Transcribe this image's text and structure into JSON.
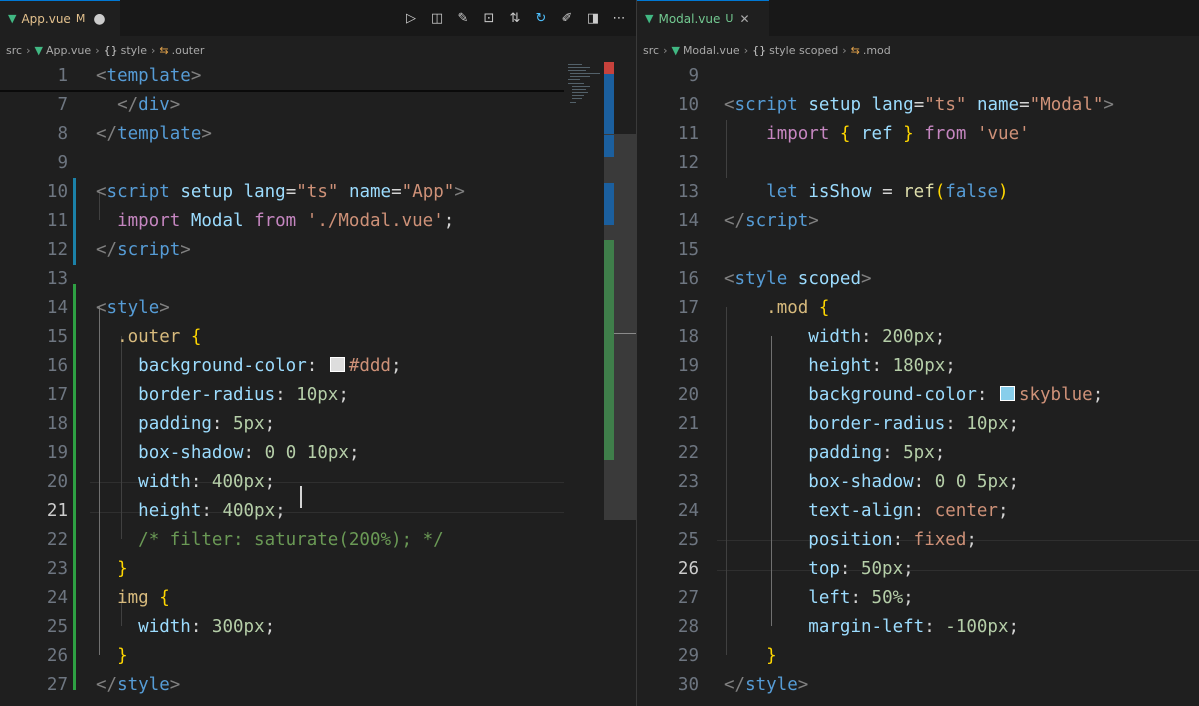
{
  "left": {
    "tab": {
      "icon": "vue-icon",
      "name": "App.vue",
      "status": "M",
      "dirty": "●"
    },
    "toolbar": [
      {
        "name": "run-icon",
        "glyph": "▷"
      },
      {
        "name": "open-preview-icon",
        "glyph": "◫"
      },
      {
        "name": "edit-note-icon",
        "glyph": "✎"
      },
      {
        "name": "compare-icon",
        "glyph": "⊡"
      },
      {
        "name": "git-compare-icon",
        "glyph": "⇅"
      },
      {
        "name": "refresh-icon",
        "glyph": "↻"
      },
      {
        "name": "pen-icon",
        "glyph": "✐"
      },
      {
        "name": "split-editor-icon",
        "glyph": "◨"
      },
      {
        "name": "more-actions-icon",
        "glyph": "⋯"
      }
    ],
    "breadcrumb": {
      "folder": "src",
      "file": "App.vue",
      "section_icon": "{}",
      "section": "style",
      "selector_icon": "⇆",
      "selector": ".outer"
    },
    "lines": [
      {
        "n": "1",
        "tokens": [
          [
            "t-p",
            "<"
          ],
          [
            "t-tag",
            "template"
          ],
          [
            "t-p",
            ">"
          ]
        ]
      },
      {
        "n": "7",
        "tokens": [
          [
            "t-txt",
            "  "
          ],
          [
            "t-p",
            "</"
          ],
          [
            "t-tag",
            "div"
          ],
          [
            "t-p",
            ">"
          ]
        ]
      },
      {
        "n": "8",
        "tokens": [
          [
            "t-p",
            "</"
          ],
          [
            "t-tag",
            "template"
          ],
          [
            "t-p",
            ">"
          ]
        ]
      },
      {
        "n": "9",
        "tokens": []
      },
      {
        "n": "10",
        "tokens": [
          [
            "t-p",
            "<"
          ],
          [
            "t-tag",
            "script"
          ],
          [
            "t-txt",
            " "
          ],
          [
            "t-attr",
            "setup"
          ],
          [
            "t-txt",
            " "
          ],
          [
            "t-attr",
            "lang"
          ],
          [
            "t-txt",
            "="
          ],
          [
            "t-str",
            "\"ts\""
          ],
          [
            "t-txt",
            " "
          ],
          [
            "t-attr",
            "name"
          ],
          [
            "t-txt",
            "="
          ],
          [
            "t-str",
            "\"App\""
          ],
          [
            "t-p",
            ">"
          ]
        ]
      },
      {
        "n": "11",
        "tokens": [
          [
            "t-txt",
            "  "
          ],
          [
            "t-kw",
            "import"
          ],
          [
            "t-txt",
            " "
          ],
          [
            "t-var",
            "Modal"
          ],
          [
            "t-txt",
            " "
          ],
          [
            "t-kw",
            "from"
          ],
          [
            "t-txt",
            " "
          ],
          [
            "t-str",
            "'./Modal.vue'"
          ],
          [
            "t-txt",
            ";"
          ]
        ]
      },
      {
        "n": "12",
        "tokens": [
          [
            "t-p",
            "</"
          ],
          [
            "t-tag",
            "script"
          ],
          [
            "t-p",
            ">"
          ]
        ]
      },
      {
        "n": "13",
        "tokens": []
      },
      {
        "n": "14",
        "tokens": [
          [
            "t-p",
            "<"
          ],
          [
            "t-tag",
            "style"
          ],
          [
            "t-p",
            ">"
          ]
        ]
      },
      {
        "n": "15",
        "tokens": [
          [
            "t-txt",
            "  "
          ],
          [
            "t-cls",
            ".outer"
          ],
          [
            "t-txt",
            " "
          ],
          [
            "t-b1",
            "{"
          ]
        ]
      },
      {
        "n": "16",
        "tokens": [
          [
            "t-txt",
            "    "
          ],
          [
            "t-prop",
            "background-color"
          ],
          [
            "t-txt",
            ": "
          ],
          [
            "swatch",
            "#dddddd"
          ],
          [
            "t-val",
            "#ddd"
          ],
          [
            "t-txt",
            ";"
          ]
        ]
      },
      {
        "n": "17",
        "tokens": [
          [
            "t-txt",
            "    "
          ],
          [
            "t-prop",
            "border-radius"
          ],
          [
            "t-txt",
            ": "
          ],
          [
            "t-num",
            "10px"
          ],
          [
            "t-txt",
            ";"
          ]
        ]
      },
      {
        "n": "18",
        "tokens": [
          [
            "t-txt",
            "    "
          ],
          [
            "t-prop",
            "padding"
          ],
          [
            "t-txt",
            ": "
          ],
          [
            "t-num",
            "5px"
          ],
          [
            "t-txt",
            ";"
          ]
        ]
      },
      {
        "n": "19",
        "tokens": [
          [
            "t-txt",
            "    "
          ],
          [
            "t-prop",
            "box-shadow"
          ],
          [
            "t-txt",
            ": "
          ],
          [
            "t-num",
            "0"
          ],
          [
            "t-txt",
            " "
          ],
          [
            "t-num",
            "0"
          ],
          [
            "t-txt",
            " "
          ],
          [
            "t-num",
            "10px"
          ],
          [
            "t-txt",
            ";"
          ]
        ]
      },
      {
        "n": "20",
        "tokens": [
          [
            "t-txt",
            "    "
          ],
          [
            "t-prop",
            "width"
          ],
          [
            "t-txt",
            ": "
          ],
          [
            "t-num",
            "400px"
          ],
          [
            "t-txt",
            ";"
          ]
        ]
      },
      {
        "n": "21",
        "tokens": [
          [
            "t-txt",
            "    "
          ],
          [
            "t-prop",
            "height"
          ],
          [
            "t-txt",
            ": "
          ],
          [
            "t-num",
            "400px"
          ],
          [
            "t-txt",
            ";"
          ]
        ]
      },
      {
        "n": "22",
        "tokens": [
          [
            "t-txt",
            "    "
          ],
          [
            "t-com",
            "/* filter: saturate(200%); */"
          ]
        ]
      },
      {
        "n": "23",
        "tokens": [
          [
            "t-txt",
            "  "
          ],
          [
            "t-b1",
            "}"
          ]
        ]
      },
      {
        "n": "24",
        "tokens": [
          [
            "t-txt",
            "  "
          ],
          [
            "t-cls",
            "img"
          ],
          [
            "t-txt",
            " "
          ],
          [
            "t-b1",
            "{"
          ]
        ]
      },
      {
        "n": "25",
        "tokens": [
          [
            "t-txt",
            "    "
          ],
          [
            "t-prop",
            "width"
          ],
          [
            "t-txt",
            ": "
          ],
          [
            "t-num",
            "300px"
          ],
          [
            "t-txt",
            ";"
          ]
        ]
      },
      {
        "n": "26",
        "tokens": [
          [
            "t-txt",
            "  "
          ],
          [
            "t-b1",
            "}"
          ]
        ]
      },
      {
        "n": "27",
        "tokens": [
          [
            "t-p",
            "</"
          ],
          [
            "t-tag",
            "style"
          ],
          [
            "t-p",
            ">"
          ]
        ]
      }
    ],
    "active_line": "21"
  },
  "right": {
    "tab": {
      "icon": "vue-icon",
      "name": "Modal.vue",
      "status": "U",
      "close": "✕"
    },
    "breadcrumb": {
      "folder": "src",
      "file": "Modal.vue",
      "section_icon": "{}",
      "section": "style scoped",
      "selector_icon": "⇆",
      "selector": ".mod"
    },
    "lines": [
      {
        "n": "9",
        "tokens": []
      },
      {
        "n": "10",
        "tokens": [
          [
            "t-p",
            "<"
          ],
          [
            "t-tag",
            "script"
          ],
          [
            "t-txt",
            " "
          ],
          [
            "t-attr",
            "setup"
          ],
          [
            "t-txt",
            " "
          ],
          [
            "t-attr",
            "lang"
          ],
          [
            "t-txt",
            "="
          ],
          [
            "t-str",
            "\"ts\""
          ],
          [
            "t-txt",
            " "
          ],
          [
            "t-attr",
            "name"
          ],
          [
            "t-txt",
            "="
          ],
          [
            "t-str",
            "\"Modal\""
          ],
          [
            "t-p",
            ">"
          ]
        ]
      },
      {
        "n": "11",
        "tokens": [
          [
            "t-txt",
            "    "
          ],
          [
            "t-kw",
            "import"
          ],
          [
            "t-txt",
            " "
          ],
          [
            "t-b1",
            "{"
          ],
          [
            "t-txt",
            " "
          ],
          [
            "t-var",
            "ref"
          ],
          [
            "t-txt",
            " "
          ],
          [
            "t-b1",
            "}"
          ],
          [
            "t-txt",
            " "
          ],
          [
            "t-kw",
            "from"
          ],
          [
            "t-txt",
            " "
          ],
          [
            "t-str",
            "'vue'"
          ]
        ]
      },
      {
        "n": "12",
        "tokens": []
      },
      {
        "n": "13",
        "tokens": [
          [
            "t-txt",
            "    "
          ],
          [
            "t-const",
            "let"
          ],
          [
            "t-txt",
            " "
          ],
          [
            "t-var",
            "isShow"
          ],
          [
            "t-txt",
            " = "
          ],
          [
            "t-fn",
            "ref"
          ],
          [
            "t-b1",
            "("
          ],
          [
            "t-const",
            "false"
          ],
          [
            "t-b1",
            ")"
          ]
        ]
      },
      {
        "n": "14",
        "tokens": [
          [
            "t-p",
            "</"
          ],
          [
            "t-tag",
            "script"
          ],
          [
            "t-p",
            ">"
          ]
        ]
      },
      {
        "n": "15",
        "tokens": []
      },
      {
        "n": "16",
        "tokens": [
          [
            "t-p",
            "<"
          ],
          [
            "t-tag",
            "style"
          ],
          [
            "t-txt",
            " "
          ],
          [
            "t-attr",
            "scoped"
          ],
          [
            "t-p",
            ">"
          ]
        ]
      },
      {
        "n": "17",
        "tokens": [
          [
            "t-txt",
            "    "
          ],
          [
            "t-cls",
            ".mod"
          ],
          [
            "t-txt",
            " "
          ],
          [
            "t-b1",
            "{"
          ]
        ]
      },
      {
        "n": "18",
        "tokens": [
          [
            "t-txt",
            "        "
          ],
          [
            "t-prop",
            "width"
          ],
          [
            "t-txt",
            ": "
          ],
          [
            "t-num",
            "200px"
          ],
          [
            "t-txt",
            ";"
          ]
        ]
      },
      {
        "n": "19",
        "tokens": [
          [
            "t-txt",
            "        "
          ],
          [
            "t-prop",
            "height"
          ],
          [
            "t-txt",
            ": "
          ],
          [
            "t-num",
            "180px"
          ],
          [
            "t-txt",
            ";"
          ]
        ]
      },
      {
        "n": "20",
        "tokens": [
          [
            "t-txt",
            "        "
          ],
          [
            "t-prop",
            "background-color"
          ],
          [
            "t-txt",
            ": "
          ],
          [
            "swatch",
            "#87ceeb"
          ],
          [
            "t-val",
            "skyblue"
          ],
          [
            "t-txt",
            ";"
          ]
        ]
      },
      {
        "n": "21",
        "tokens": [
          [
            "t-txt",
            "        "
          ],
          [
            "t-prop",
            "border-radius"
          ],
          [
            "t-txt",
            ": "
          ],
          [
            "t-num",
            "10px"
          ],
          [
            "t-txt",
            ";"
          ]
        ]
      },
      {
        "n": "22",
        "tokens": [
          [
            "t-txt",
            "        "
          ],
          [
            "t-prop",
            "padding"
          ],
          [
            "t-txt",
            ": "
          ],
          [
            "t-num",
            "5px"
          ],
          [
            "t-txt",
            ";"
          ]
        ]
      },
      {
        "n": "23",
        "tokens": [
          [
            "t-txt",
            "        "
          ],
          [
            "t-prop",
            "box-shadow"
          ],
          [
            "t-txt",
            ": "
          ],
          [
            "t-num",
            "0"
          ],
          [
            "t-txt",
            " "
          ],
          [
            "t-num",
            "0"
          ],
          [
            "t-txt",
            " "
          ],
          [
            "t-num",
            "5px"
          ],
          [
            "t-txt",
            ";"
          ]
        ]
      },
      {
        "n": "24",
        "tokens": [
          [
            "t-txt",
            "        "
          ],
          [
            "t-prop",
            "text-align"
          ],
          [
            "t-txt",
            ": "
          ],
          [
            "t-val",
            "center"
          ],
          [
            "t-txt",
            ";"
          ]
        ]
      },
      {
        "n": "25",
        "tokens": [
          [
            "t-txt",
            "        "
          ],
          [
            "t-prop",
            "position"
          ],
          [
            "t-txt",
            ": "
          ],
          [
            "t-val",
            "fixed"
          ],
          [
            "t-txt",
            ";"
          ]
        ]
      },
      {
        "n": "26",
        "tokens": [
          [
            "t-txt",
            "        "
          ],
          [
            "t-prop",
            "top"
          ],
          [
            "t-txt",
            ": "
          ],
          [
            "t-num",
            "50px"
          ],
          [
            "t-txt",
            ";"
          ]
        ]
      },
      {
        "n": "27",
        "tokens": [
          [
            "t-txt",
            "        "
          ],
          [
            "t-prop",
            "left"
          ],
          [
            "t-txt",
            ": "
          ],
          [
            "t-num",
            "50%"
          ],
          [
            "t-txt",
            ";"
          ]
        ]
      },
      {
        "n": "28",
        "tokens": [
          [
            "t-txt",
            "        "
          ],
          [
            "t-prop",
            "margin-left"
          ],
          [
            "t-txt",
            ": "
          ],
          [
            "t-num",
            "-100px"
          ],
          [
            "t-txt",
            ";"
          ]
        ]
      },
      {
        "n": "29",
        "tokens": [
          [
            "t-txt",
            "    "
          ],
          [
            "t-b1",
            "}"
          ]
        ]
      },
      {
        "n": "30",
        "tokens": [
          [
            "t-p",
            "</"
          ],
          [
            "t-tag",
            "style"
          ],
          [
            "t-p",
            ">"
          ]
        ]
      }
    ],
    "active_line": "26"
  },
  "colors": {
    "accent": "#0078d4",
    "modified": "#e2c08d",
    "vue": "#41b883",
    "git_added": "#2ea043",
    "git_modified": "#1b81a8"
  }
}
